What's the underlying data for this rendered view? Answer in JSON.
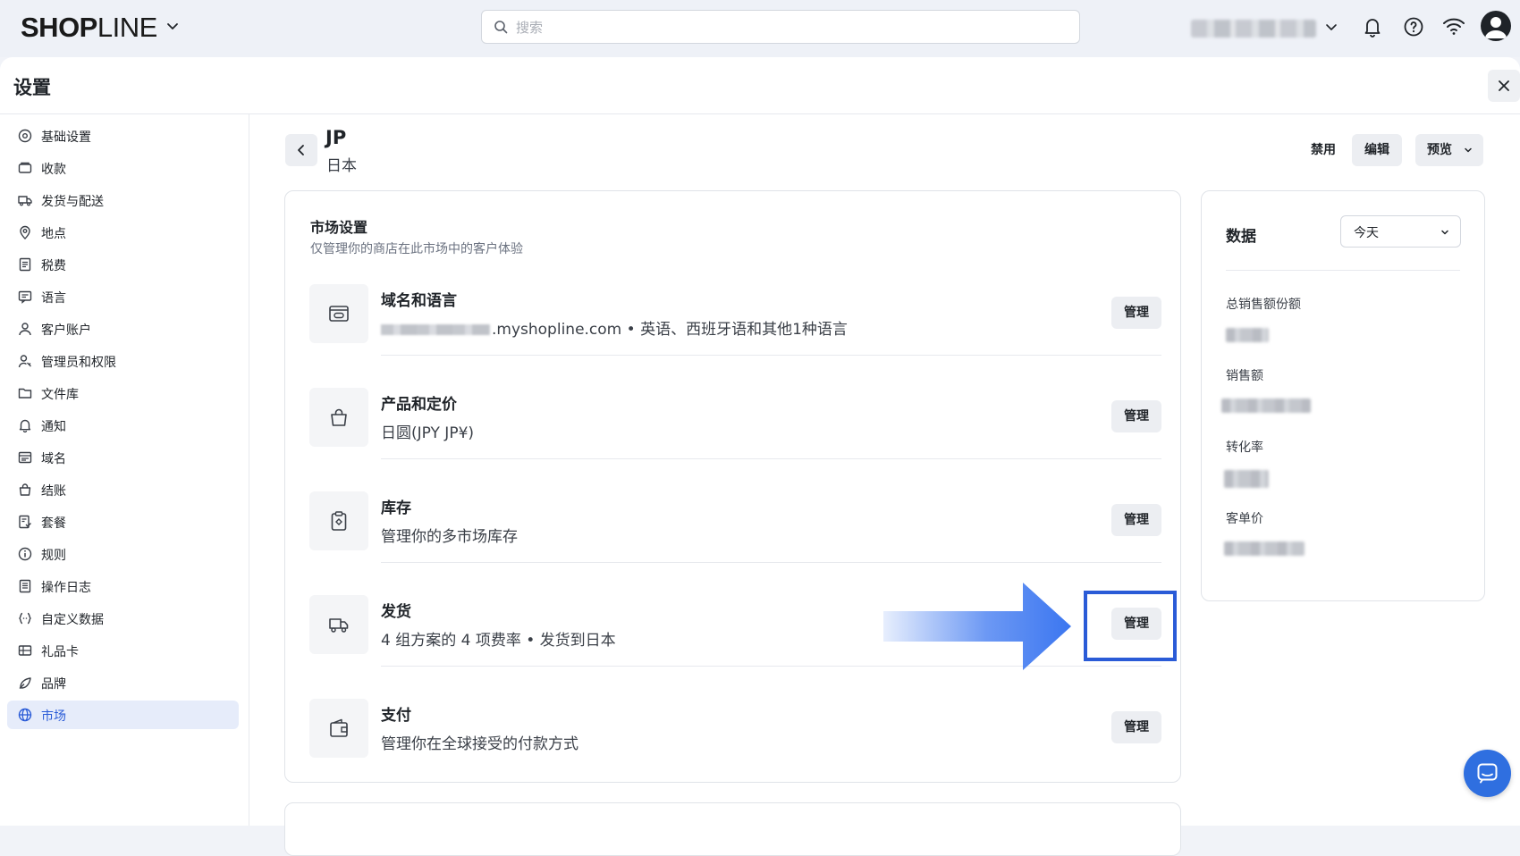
{
  "header": {
    "logo": {
      "bold": "SHOP",
      "light": "LINE"
    },
    "search_placeholder": "搜索"
  },
  "panel": {
    "title": "设置"
  },
  "sidebar": {
    "items": [
      {
        "label": "基础设置",
        "icon": "settings-icon"
      },
      {
        "label": "收款",
        "icon": "payment-icon"
      },
      {
        "label": "发货与配送",
        "icon": "truck-icon"
      },
      {
        "label": "地点",
        "icon": "location-pin-icon"
      },
      {
        "label": "税费",
        "icon": "receipt-icon"
      },
      {
        "label": "语言",
        "icon": "language-icon"
      },
      {
        "label": "客户账户",
        "icon": "user-icon"
      },
      {
        "label": "管理员和权限",
        "icon": "admin-key-icon"
      },
      {
        "label": "文件库",
        "icon": "folder-icon"
      },
      {
        "label": "通知",
        "icon": "bell-icon"
      },
      {
        "label": "域名",
        "icon": "domain-icon"
      },
      {
        "label": "结账",
        "icon": "shopping-bag-icon"
      },
      {
        "label": "套餐",
        "icon": "plan-icon"
      },
      {
        "label": "规则",
        "icon": "info-icon"
      },
      {
        "label": "操作日志",
        "icon": "log-icon"
      },
      {
        "label": "自定义数据",
        "icon": "code-braces-icon"
      },
      {
        "label": "礼品卡",
        "icon": "gift-card-icon"
      },
      {
        "label": "品牌",
        "icon": "brand-icon"
      },
      {
        "label": "市场",
        "icon": "globe-icon",
        "active": true
      }
    ]
  },
  "market": {
    "code": "JP",
    "name": "日本",
    "actions": {
      "disable": "禁用",
      "edit": "编辑",
      "preview": "预览"
    }
  },
  "market_settings": {
    "title": "市场设置",
    "subtitle": "仅管理你的商店在此市场中的客户体验",
    "rows": [
      {
        "title": "域名和语言",
        "desc": ".myshopline.com • 英语、西班牙语和其他1种语言",
        "button": "管理",
        "icon": "domain-language-icon"
      },
      {
        "title": "产品和定价",
        "desc": "日圆(JPY JP¥)",
        "button": "管理",
        "icon": "shopping-bag-icon"
      },
      {
        "title": "库存",
        "desc": "管理你的多市场库存",
        "button": "管理",
        "icon": "clipboard-icon"
      },
      {
        "title": "发货",
        "desc": "4 组方案的 4 项费率 • 发货到日本",
        "button": "管理",
        "icon": "truck-icon"
      },
      {
        "title": "支付",
        "desc": "管理你在全球接受的付款方式",
        "button": "管理",
        "icon": "wallet-icon"
      }
    ]
  },
  "data_panel": {
    "title": "数据",
    "range": "今天",
    "metrics": [
      {
        "label": "总销售额份额"
      },
      {
        "label": "销售额"
      },
      {
        "label": "转化率"
      },
      {
        "label": "客单价"
      }
    ]
  },
  "colors": {
    "accent": "#2a5bd7",
    "arrow": "#3b76f0",
    "active_nav_bg": "#e6ecfa"
  }
}
